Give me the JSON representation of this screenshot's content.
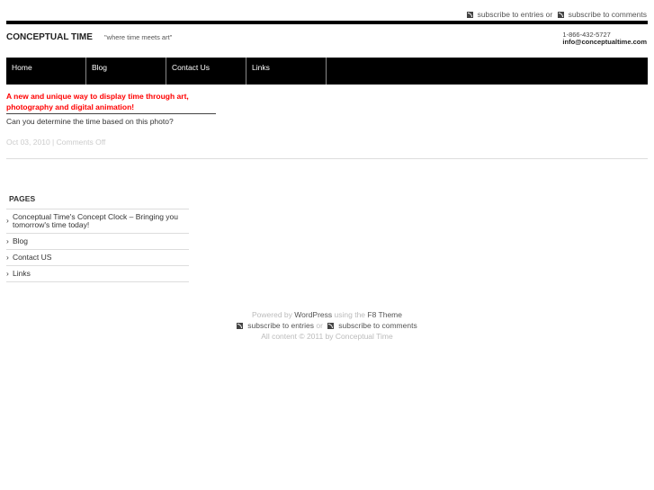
{
  "top": {
    "sub_entries": "subscribe to entries",
    "or": "or",
    "sub_comments": "subscribe to comments"
  },
  "header": {
    "title": "CONCEPTUAL TIME",
    "tagline": "\"where time meets art\"",
    "phone": "1-866-432-5727",
    "email": "info@conceptualtime.com"
  },
  "nav": [
    "Home",
    "Blog",
    "Contact Us",
    "Links"
  ],
  "post": {
    "title": "A new and unique way to display time through art, photography and digital animation!",
    "text": "Can you determine the time based on this photo?",
    "date": "Oct 03, 2010",
    "sep": "|",
    "comments": "Comments Off"
  },
  "sidebar": {
    "heading": "PAGES",
    "items": [
      "Conceptual Time's Concept Clock – Bringing you tomorrow's time today!",
      "Blog",
      "Contact US",
      "Links"
    ]
  },
  "footer": {
    "powered": "Powered by",
    "wordpress": "WordPress",
    "using": "using the",
    "theme": "F8 Theme",
    "sub_entries": "subscribe to entries",
    "or": "or",
    "sub_comments": "subscribe to comments",
    "copyright": "All content © 2011 by Conceptual Time"
  }
}
